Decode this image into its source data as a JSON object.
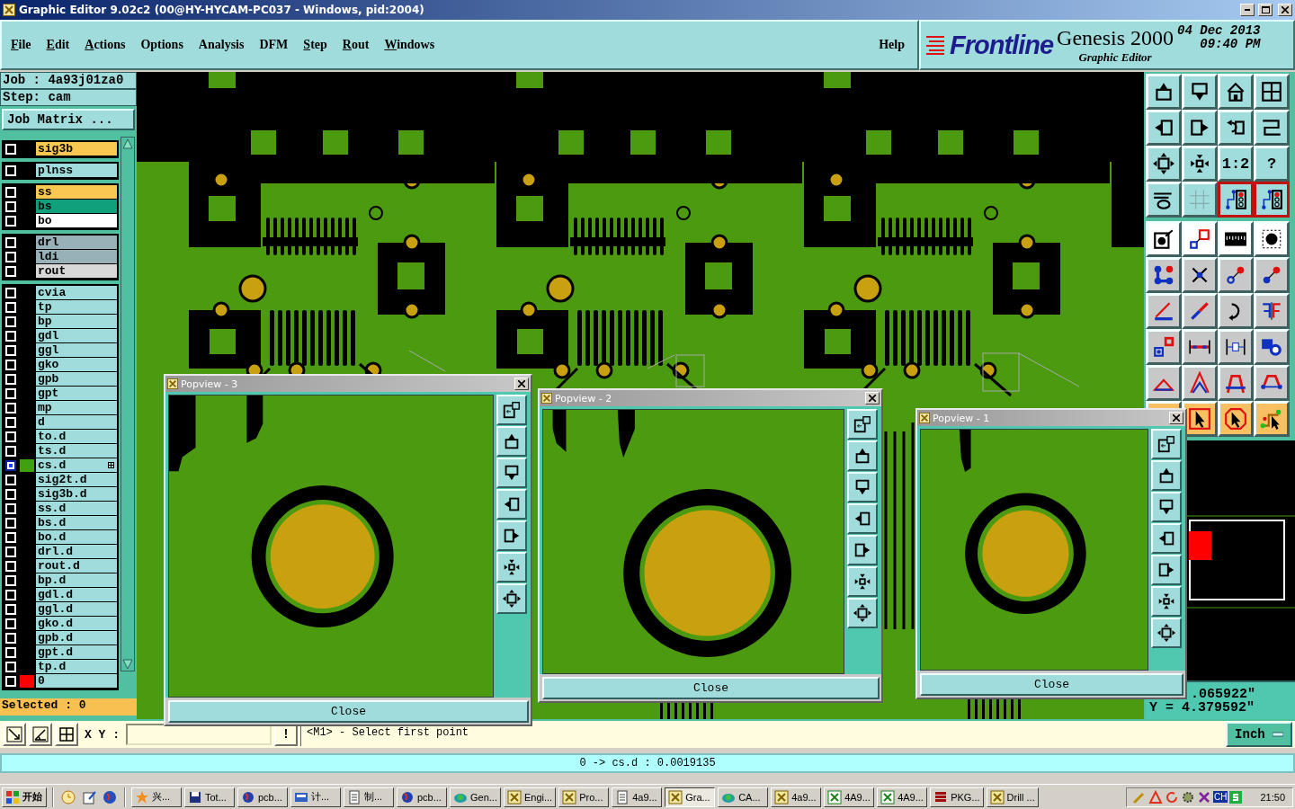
{
  "window": {
    "title": "Graphic Editor 9.02c2 (00@HY-HYCAM-PC037 - Windows, pid:2004)"
  },
  "menu": [
    {
      "label": "File",
      "mnemonic": true
    },
    {
      "label": "Edit",
      "mnemonic": true
    },
    {
      "label": "Actions",
      "mnemonic": true
    },
    {
      "label": "Options",
      "mnemonic": false
    },
    {
      "label": "Analysis",
      "mnemonic": false
    },
    {
      "label": "DFM",
      "mnemonic": false
    },
    {
      "label": "Step",
      "mnemonic": true
    },
    {
      "label": "Rout",
      "mnemonic": true
    },
    {
      "label": "Windows",
      "mnemonic": true
    }
  ],
  "help": "Help",
  "brand": {
    "logo": "Frontline",
    "product": "Genesis 2000",
    "subtitle": "Graphic Editor",
    "date": "04 Dec 2013",
    "time": "09:40 PM"
  },
  "job": "Job : 4a93j01za0",
  "step": "Step: cam",
  "matrix_button": "Job Matrix ...",
  "layer_groups": [
    {
      "layers": [
        {
          "name": "sig3b",
          "color": "#f8c850",
          "selected": false
        }
      ]
    },
    {
      "layers": [
        {
          "name": "plnss",
          "color": "#a0dcdc",
          "selected": false
        }
      ]
    },
    {
      "layers": [
        {
          "name": "ss",
          "color": "#f8c850",
          "selected": false
        },
        {
          "name": "bs",
          "color": "#10a07c",
          "selected": false
        },
        {
          "name": "bo",
          "color": "#ffffff",
          "selected": false
        }
      ]
    },
    {
      "layers": [
        {
          "name": "drl",
          "color": "#98b0b8",
          "selected": false
        },
        {
          "name": "ldi",
          "color": "#98b0b8",
          "selected": false
        },
        {
          "name": "rout",
          "color": "#d8d8d8",
          "selected": false
        }
      ]
    },
    {
      "layers": [
        {
          "name": "cvia",
          "color": "#a0dcdc",
          "selected": false
        },
        {
          "name": "tp",
          "color": "#a0dcdc",
          "selected": false
        },
        {
          "name": "bp",
          "color": "#a0dcdc",
          "selected": false
        },
        {
          "name": "gdl",
          "color": "#a0dcdc",
          "selected": false
        },
        {
          "name": "ggl",
          "color": "#a0dcdc",
          "selected": false
        },
        {
          "name": "gko",
          "color": "#a0dcdc",
          "selected": false
        },
        {
          "name": "gpb",
          "color": "#a0dcdc",
          "selected": false
        },
        {
          "name": "gpt",
          "color": "#a0dcdc",
          "selected": false
        },
        {
          "name": "mp",
          "color": "#a0dcdc",
          "selected": false
        },
        {
          "name": "d",
          "color": "#a0dcdc",
          "selected": false
        },
        {
          "name": "to.d",
          "color": "#a0dcdc",
          "selected": false
        },
        {
          "name": "ts.d",
          "color": "#a0dcdc",
          "selected": false
        },
        {
          "name": "cs.d",
          "color": "#a0dcdc",
          "swatch": {
            "color": "#40a010"
          },
          "selected": true
        },
        {
          "name": "sig2t.d",
          "color": "#a0dcdc",
          "selected": false
        },
        {
          "name": "sig3b.d",
          "color": "#a0dcdc",
          "selected": false
        },
        {
          "name": "ss.d",
          "color": "#a0dcdc",
          "selected": false
        },
        {
          "name": "bs.d",
          "color": "#a0dcdc",
          "selected": false
        },
        {
          "name": "bo.d",
          "color": "#a0dcdc",
          "selected": false
        },
        {
          "name": "drl.d",
          "color": "#a0dcdc",
          "selected": false
        },
        {
          "name": "rout.d",
          "color": "#a0dcdc",
          "selected": false
        },
        {
          "name": "bp.d",
          "color": "#a0dcdc",
          "selected": false
        },
        {
          "name": "gdl.d",
          "color": "#a0dcdc",
          "selected": false
        },
        {
          "name": "ggl.d",
          "color": "#a0dcdc",
          "selected": false
        },
        {
          "name": "gko.d",
          "color": "#a0dcdc",
          "selected": false
        },
        {
          "name": "gpb.d",
          "color": "#a0dcdc",
          "selected": false
        },
        {
          "name": "gpt.d",
          "color": "#a0dcdc",
          "selected": false
        },
        {
          "name": "tp.d",
          "color": "#a0dcdc",
          "selected": false
        },
        {
          "name": "0",
          "color": "#a0dcdc",
          "swatch": {
            "color": "#ff0000"
          },
          "selected": false
        }
      ]
    }
  ],
  "selected_count": "Selected : 0",
  "toolbar": {
    "ratio_label": "1:2",
    "help_label": "?",
    "toggles": [
      {
        "on": true
      },
      {
        "on": true
      }
    ]
  },
  "coords": {
    "x": ".065922\"",
    "y": "Y = 4.379592\""
  },
  "popviews": [
    {
      "title": "Popview - 3",
      "close": "Close"
    },
    {
      "title": "Popview - 2",
      "close": "Close"
    },
    {
      "title": "Popview - 1",
      "close": "Close"
    }
  ],
  "command": {
    "label": "X Y :",
    "bang": "!",
    "prompt": "<M1> - Select first point",
    "units": "Inch"
  },
  "status": "0 -> cs.d : 0.0019135",
  "taskbar": {
    "start": "开始",
    "tasks": [
      {
        "label": "兴...",
        "kind": "star",
        "selected": false
      },
      {
        "label": "Tot...",
        "kind": "disk",
        "selected": false
      },
      {
        "label": "pcb...",
        "kind": "globe",
        "selected": false
      },
      {
        "label": "计...",
        "kind": "calc",
        "selected": false
      },
      {
        "label": "制...",
        "kind": "doc",
        "selected": false
      },
      {
        "label": "pcb...",
        "kind": "globe",
        "selected": false
      },
      {
        "label": "Gen...",
        "kind": "net",
        "selected": false
      },
      {
        "label": "Engi...",
        "kind": "xwin",
        "selected": false
      },
      {
        "label": "Pro...",
        "kind": "xwin",
        "selected": false
      },
      {
        "label": "4a9...",
        "kind": "doc",
        "selected": false
      },
      {
        "label": "Gra...",
        "kind": "xwin",
        "selected": true
      },
      {
        "label": "CA...",
        "kind": "net",
        "selected": false
      },
      {
        "label": "4a9...",
        "kind": "xwin",
        "selected": false
      },
      {
        "label": "4A9...",
        "kind": "excel",
        "selected": false
      },
      {
        "label": "4A9...",
        "kind": "excel",
        "selected": false
      },
      {
        "label": "PKG...",
        "kind": "stack",
        "selected": false
      },
      {
        "label": "Drill ...",
        "kind": "xwin",
        "selected": false
      }
    ],
    "language": "CH",
    "clock": "21:50"
  }
}
